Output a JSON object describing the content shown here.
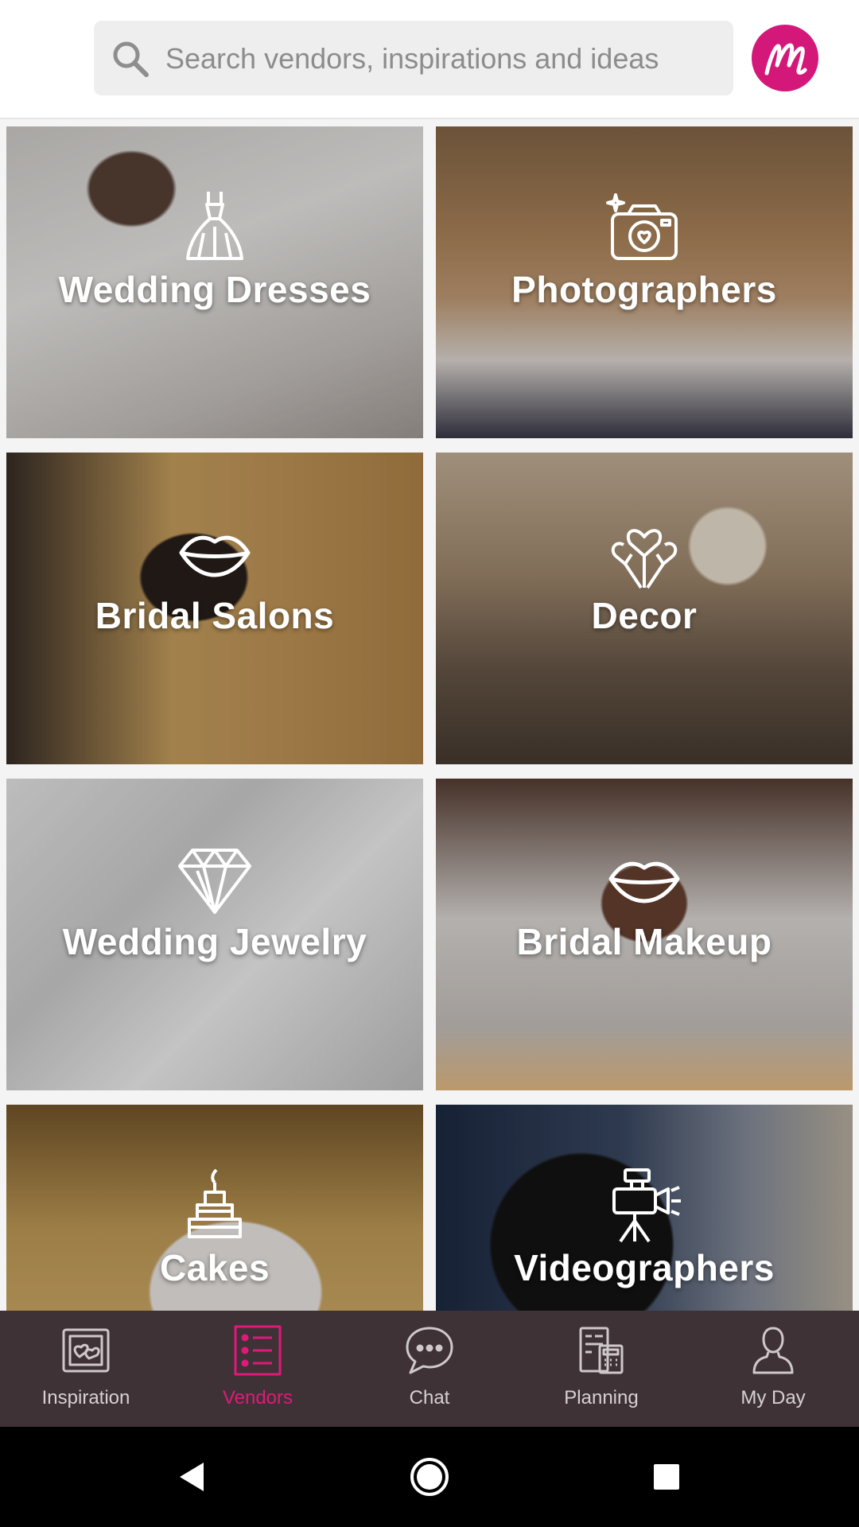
{
  "search": {
    "placeholder": "Search vendors, inspirations and ideas",
    "icon": "search-icon"
  },
  "brand": {
    "logo_letter": "m",
    "color": "#d4187a"
  },
  "categories": [
    {
      "label": "Wedding Dresses",
      "icon": "dress-icon"
    },
    {
      "label": "Photographers",
      "icon": "camera-icon"
    },
    {
      "label": "Bridal Salons",
      "icon": "lips-icon"
    },
    {
      "label": "Decor",
      "icon": "balloons-icon"
    },
    {
      "label": "Wedding Jewelry",
      "icon": "diamond-icon"
    },
    {
      "label": "Bridal Makeup",
      "icon": "lips-icon"
    },
    {
      "label": "Cakes",
      "icon": "cake-icon"
    },
    {
      "label": "Videographers",
      "icon": "video-camera-icon"
    }
  ],
  "bottom_nav": {
    "items": [
      {
        "label": "Inspiration",
        "icon": "inspiration-icon",
        "active": false
      },
      {
        "label": "Vendors",
        "icon": "vendors-list-icon",
        "active": true
      },
      {
        "label": "Chat",
        "icon": "chat-icon",
        "active": false
      },
      {
        "label": "Planning",
        "icon": "planning-icon",
        "active": false
      },
      {
        "label": "My Day",
        "icon": "profile-icon",
        "active": false
      }
    ],
    "active_color": "#e0197a",
    "background": "#3e3236"
  },
  "system_nav": {
    "back": "back-icon",
    "home": "home-icon",
    "recents": "recents-icon"
  }
}
